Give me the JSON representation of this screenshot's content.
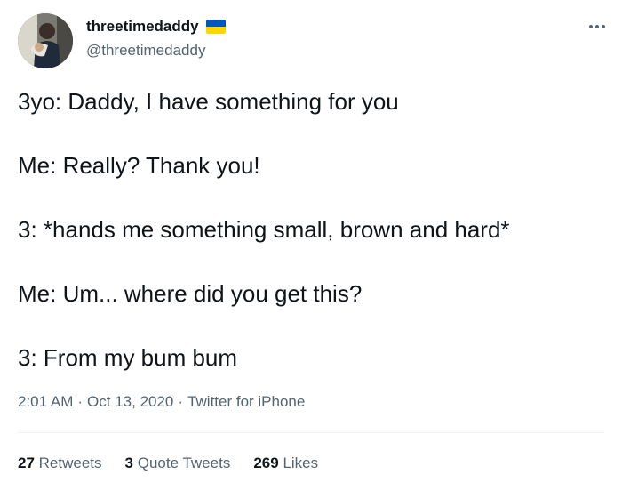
{
  "author": {
    "display_name": "threetimedaddy",
    "handle": "@threetimedaddy"
  },
  "tweet": {
    "lines": [
      "3yo: Daddy, I have something for you",
      "Me: Really? Thank you!",
      "3: *hands me something small, brown and hard*",
      "Me: Um... where did you get this?",
      "3: From my bum bum"
    ],
    "time": "2:01 AM",
    "separator": "·",
    "date": "Oct 13, 2020",
    "source": "Twitter for iPhone"
  },
  "stats": {
    "retweets_count": "27",
    "retweets_label": "Retweets",
    "quotes_count": "3",
    "quotes_label": "Quote Tweets",
    "likes_count": "269",
    "likes_label": "Likes"
  },
  "colors": {
    "text_primary": "#0f1419",
    "text_secondary": "#536471",
    "divider": "#eff3f4",
    "flag_blue": "#0057b7",
    "flag_yellow": "#ffd700"
  },
  "icons": {
    "flag": "ukraine-flag-icon",
    "more": "more-options-icon"
  }
}
